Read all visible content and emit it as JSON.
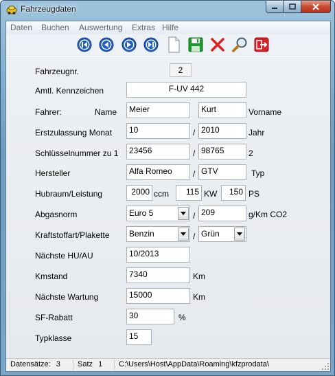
{
  "window": {
    "title": "Fahrzeugdaten"
  },
  "menu": [
    "Daten",
    "Buchen",
    "Auswertung",
    "Extras",
    "Hilfe"
  ],
  "toolbar": [
    {
      "name": "first-record-button",
      "icon": "first-icon"
    },
    {
      "name": "previous-record-button",
      "icon": "previous-icon"
    },
    {
      "name": "next-record-button",
      "icon": "next-icon"
    },
    {
      "name": "last-record-button",
      "icon": "last-icon"
    },
    {
      "name": "new-record-button",
      "icon": "new-document-icon"
    },
    {
      "name": "save-button",
      "icon": "save-icon"
    },
    {
      "name": "delete-button",
      "icon": "delete-x-icon"
    },
    {
      "name": "search-button",
      "icon": "search-icon"
    },
    {
      "name": "exit-button",
      "icon": "exit-icon"
    }
  ],
  "form": {
    "fahrzeugnr": {
      "label": "Fahrzeugnr.",
      "value": "2"
    },
    "kennzeichen": {
      "label": "Amtl. Kennzeichen",
      "value": "F-UV 442"
    },
    "fahrer": {
      "label": "Fahrer:",
      "name_label": "Name",
      "name": "Meier",
      "vorname": "Kurt",
      "vorname_label": "Vorname"
    },
    "erstzulassung": {
      "label": "Erstzulassung Monat",
      "monat": "10",
      "sep": "/",
      "jahr": "2010",
      "jahr_label": "Jahr"
    },
    "schluessel": {
      "label": "Schlüsselnummer zu 1",
      "nr1": "23456",
      "sep": "/",
      "nr2": "98765",
      "suffix": "2"
    },
    "hersteller": {
      "label": "Hersteller",
      "value": "Alfa Romeo",
      "sep": "/",
      "typ": "GTV",
      "typ_label": "Typ"
    },
    "hubraum": {
      "label": "Hubraum/Leistung",
      "ccm": "2000",
      "ccm_unit": "ccm",
      "kw": "115",
      "kw_unit": "KW",
      "ps": "150",
      "ps_unit": "PS"
    },
    "abgasnorm": {
      "label": "Abgasnorm",
      "value": "Euro 5",
      "sep": "/",
      "co2": "209",
      "co2_unit": "g/Km CO2"
    },
    "kraftstoff": {
      "label": "Kraftstoffart/Plakette",
      "value": "Benzin",
      "sep": "/",
      "plakette": "Grün"
    },
    "hu_au": {
      "label": "Nächste HU/AU",
      "value": "10/2013"
    },
    "kmstand": {
      "label": "Kmstand",
      "value": "7340",
      "unit": "Km"
    },
    "wartung": {
      "label": "Nächste Wartung",
      "value": "15000",
      "unit": "Km"
    },
    "sf_rabatt": {
      "label": "SF-Rabatt",
      "value": "30",
      "unit": "%"
    },
    "typklasse": {
      "label": "Typklasse",
      "value": "15"
    }
  },
  "status": {
    "datensaetze_label": "Datensätze:",
    "datensaetze": "3",
    "satz_label": "Satz",
    "satz": "1",
    "path": "C:\\Users\\Host\\AppData\\Roaming\\kfzprodata\\"
  },
  "colors": {
    "nav_blue": "#1f5fc4",
    "save_green": "#1a9a2a",
    "delete_red": "#e02020",
    "exit_red": "#d8222a"
  }
}
